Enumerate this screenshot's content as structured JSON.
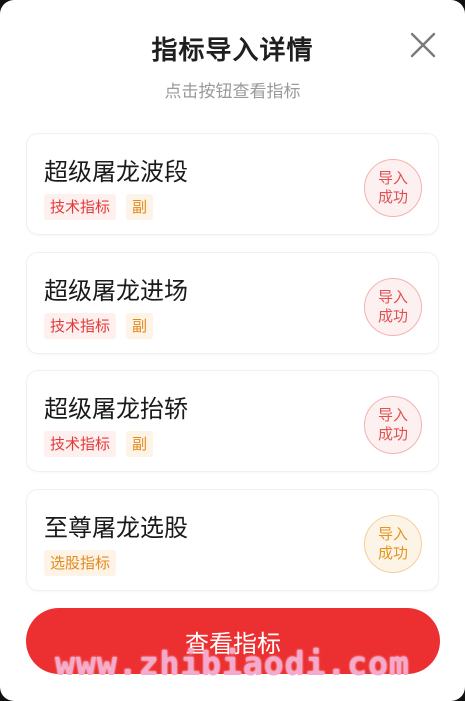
{
  "dialog": {
    "title": "指标导入详情",
    "subtitle": "点击按钮查看指标",
    "close_icon": "close-icon"
  },
  "items": [
    {
      "name": "超级屠龙波段",
      "tags": [
        {
          "label": "技术指标",
          "color": "#e23a3a"
        },
        {
          "label": "副",
          "color": "#e48a1d"
        }
      ],
      "status": "导入成功",
      "status_line1": "导入",
      "status_line2": "成功",
      "status_color": "#e05252"
    },
    {
      "name": "超级屠龙进场",
      "tags": [
        {
          "label": "技术指标",
          "color": "#e23a3a"
        },
        {
          "label": "副",
          "color": "#e48a1d"
        }
      ],
      "status": "导入成功",
      "status_line1": "导入",
      "status_line2": "成功",
      "status_color": "#e05252"
    },
    {
      "name": "超级屠龙抬轿",
      "tags": [
        {
          "label": "技术指标",
          "color": "#e23a3a"
        },
        {
          "label": "副",
          "color": "#e48a1d"
        }
      ],
      "status": "导入成功",
      "status_line1": "导入",
      "status_line2": "成功",
      "status_color": "#e05252"
    },
    {
      "name": "至尊屠龙选股",
      "tags": [
        {
          "label": "选股指标",
          "color": "#e48a1d"
        }
      ],
      "status": "导入成功",
      "status_line1": "导入",
      "status_line2": "成功",
      "status_color": "#e6961f"
    }
  ],
  "cta": {
    "label": "查看指标",
    "color": "#ec2f30"
  },
  "watermark": "www.zhibiaodi.com"
}
